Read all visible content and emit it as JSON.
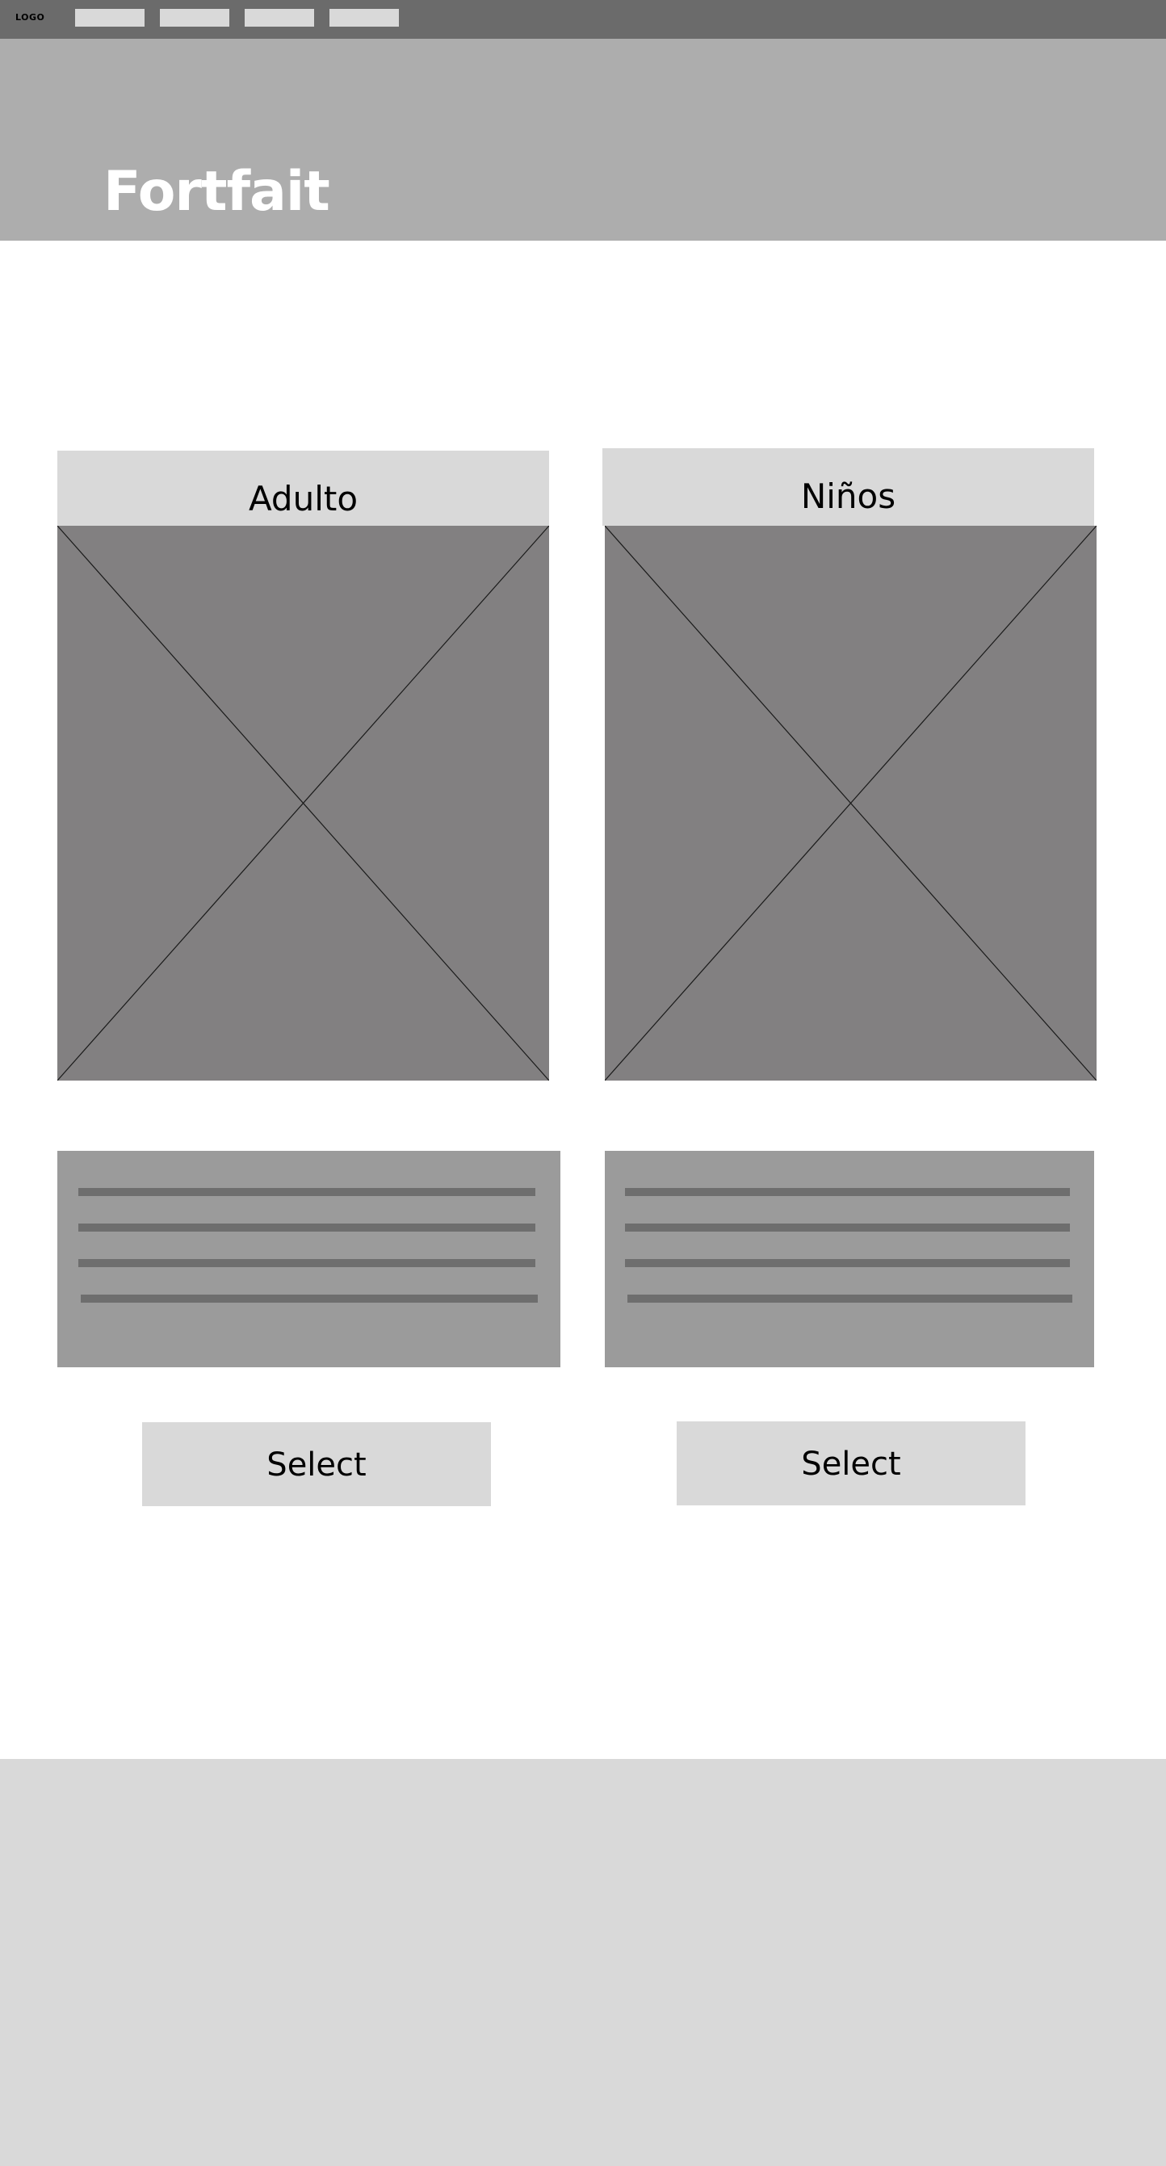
{
  "nav": {
    "logo": "LOGO",
    "items": [
      "",
      "",
      "",
      ""
    ]
  },
  "hero": {
    "title": "Fortfait"
  },
  "cards": [
    {
      "title": "Adulto",
      "select_label": "Select"
    },
    {
      "title": "Niños",
      "select_label": "Select"
    }
  ],
  "colors": {
    "nav_bg": "#6b6b6b",
    "hero_bg": "#adadad",
    "placeholder_bg": "#d9d9d9",
    "image_bg": "#828081",
    "text_block_bg": "#9b9b9b",
    "text_line": "#6e6e6e"
  }
}
